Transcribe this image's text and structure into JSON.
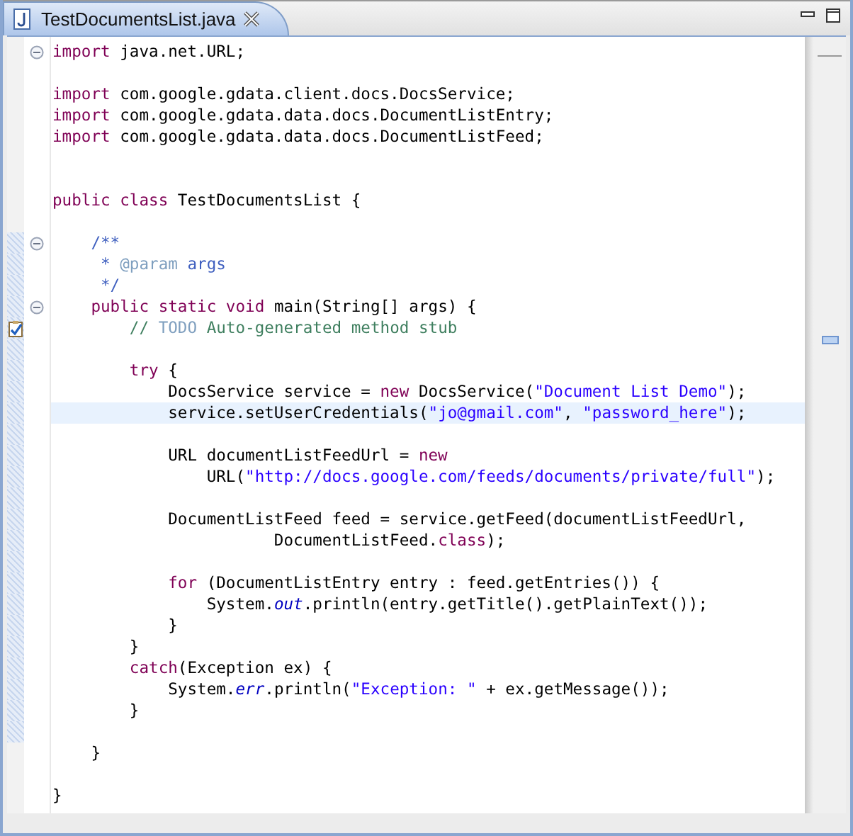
{
  "tab": {
    "label": "TestDocumentsList.java",
    "selected": true
  },
  "lines": [
    {
      "kind": "code",
      "collapsible": true,
      "tokens": [
        {
          "kind": "kw",
          "t": "import"
        },
        {
          "kind": "p",
          "t": " java.net.URL;"
        }
      ]
    },
    {
      "kind": "blank"
    },
    {
      "kind": "code",
      "tokens": [
        {
          "kind": "kw",
          "t": "import"
        },
        {
          "kind": "p",
          "t": " com.google.gdata.client.docs.DocsService;"
        }
      ]
    },
    {
      "kind": "code",
      "tokens": [
        {
          "kind": "kw",
          "t": "import"
        },
        {
          "kind": "p",
          "t": " com.google.gdata.data.docs.DocumentListEntry;"
        }
      ]
    },
    {
      "kind": "code",
      "tokens": [
        {
          "kind": "kw",
          "t": "import"
        },
        {
          "kind": "p",
          "t": " com.google.gdata.data.docs.DocumentListFeed;"
        }
      ]
    },
    {
      "kind": "blank"
    },
    {
      "kind": "blank"
    },
    {
      "kind": "code",
      "tokens": [
        {
          "kind": "kw",
          "t": "public class"
        },
        {
          "kind": "p",
          "t": " TestDocumentsList {"
        }
      ]
    },
    {
      "kind": "blank"
    },
    {
      "kind": "code",
      "collapsible": true,
      "in_range": true,
      "tokens": [
        {
          "kind": "doc",
          "t": "    /**"
        }
      ]
    },
    {
      "kind": "code",
      "in_range": true,
      "tokens": [
        {
          "kind": "doc",
          "t": "     * "
        },
        {
          "kind": "tag",
          "t": "@param"
        },
        {
          "kind": "doc",
          "t": " args"
        }
      ]
    },
    {
      "kind": "code",
      "in_range": true,
      "tokens": [
        {
          "kind": "doc",
          "t": "     */"
        }
      ]
    },
    {
      "kind": "code",
      "collapsible": true,
      "in_range": true,
      "tokens": [
        {
          "kind": "kw",
          "t": "    public static void"
        },
        {
          "kind": "p",
          "t": " main(String[] args) {"
        }
      ]
    },
    {
      "kind": "code",
      "task": true,
      "in_range": true,
      "tokens": [
        {
          "kind": "comment",
          "t": "        // "
        },
        {
          "kind": "todo",
          "t": "TODO"
        },
        {
          "kind": "comment",
          "t": " Auto-generated method stub"
        }
      ]
    },
    {
      "kind": "blank",
      "in_range": true
    },
    {
      "kind": "code",
      "in_range": true,
      "tokens": [
        {
          "kind": "kw",
          "t": "        try"
        },
        {
          "kind": "p",
          "t": " {"
        }
      ]
    },
    {
      "kind": "code",
      "in_range": true,
      "tokens": [
        {
          "kind": "p",
          "t": "            DocsService service = "
        },
        {
          "kind": "kw",
          "t": "new"
        },
        {
          "kind": "p",
          "t": " DocsService("
        },
        {
          "kind": "str",
          "t": "\"Document List Demo\""
        },
        {
          "kind": "p",
          "t": ");"
        }
      ]
    },
    {
      "kind": "code",
      "current": true,
      "in_range": true,
      "tokens": [
        {
          "kind": "p",
          "t": "            service.setUserCredentials("
        },
        {
          "kind": "str",
          "t": "\"jo@gmail.com\""
        },
        {
          "kind": "p",
          "t": ", "
        },
        {
          "kind": "str",
          "t": "\"password_here\""
        },
        {
          "kind": "p",
          "t": ");"
        }
      ]
    },
    {
      "kind": "blank",
      "in_range": true
    },
    {
      "kind": "code",
      "in_range": true,
      "tokens": [
        {
          "kind": "p",
          "t": "            URL documentListFeedUrl = "
        },
        {
          "kind": "kw",
          "t": "new"
        }
      ]
    },
    {
      "kind": "code",
      "in_range": true,
      "tokens": [
        {
          "kind": "p",
          "t": "                URL("
        },
        {
          "kind": "str",
          "t": "\"http://docs.google.com/feeds/documents/private/full\""
        },
        {
          "kind": "p",
          "t": ");"
        }
      ]
    },
    {
      "kind": "blank",
      "in_range": true
    },
    {
      "kind": "code",
      "in_range": true,
      "tokens": [
        {
          "kind": "p",
          "t": "            DocumentListFeed feed = service.getFeed(documentListFeedUrl,"
        }
      ]
    },
    {
      "kind": "code",
      "in_range": true,
      "tokens": [
        {
          "kind": "p",
          "t": "                       DocumentListFeed."
        },
        {
          "kind": "kw",
          "t": "class"
        },
        {
          "kind": "p",
          "t": ");"
        }
      ]
    },
    {
      "kind": "blank",
      "in_range": true
    },
    {
      "kind": "code",
      "in_range": true,
      "tokens": [
        {
          "kind": "kw",
          "t": "            for"
        },
        {
          "kind": "p",
          "t": " (DocumentListEntry entry : feed.getEntries()) {"
        }
      ]
    },
    {
      "kind": "code",
      "in_range": true,
      "tokens": [
        {
          "kind": "p",
          "t": "                System."
        },
        {
          "kind": "field",
          "t": "out"
        },
        {
          "kind": "p",
          "t": ".println(entry.getTitle().getPlainText());"
        }
      ]
    },
    {
      "kind": "code",
      "in_range": true,
      "tokens": [
        {
          "kind": "p",
          "t": "            }"
        }
      ]
    },
    {
      "kind": "code",
      "in_range": true,
      "tokens": [
        {
          "kind": "p",
          "t": "        }"
        }
      ]
    },
    {
      "kind": "code",
      "in_range": true,
      "tokens": [
        {
          "kind": "kw",
          "t": "        catch"
        },
        {
          "kind": "p",
          "t": "(Exception ex) {"
        }
      ]
    },
    {
      "kind": "code",
      "in_range": true,
      "tokens": [
        {
          "kind": "p",
          "t": "            System."
        },
        {
          "kind": "field",
          "t": "err"
        },
        {
          "kind": "p",
          "t": ".println("
        },
        {
          "kind": "str",
          "t": "\"Exception: \""
        },
        {
          "kind": "p",
          "t": " + ex.getMessage());"
        }
      ]
    },
    {
      "kind": "code",
      "in_range": true,
      "tokens": [
        {
          "kind": "p",
          "t": "        }"
        }
      ]
    },
    {
      "kind": "blank",
      "in_range": true
    },
    {
      "kind": "code",
      "tokens": [
        {
          "kind": "p",
          "t": "    }"
        }
      ]
    },
    {
      "kind": "blank"
    },
    {
      "kind": "code",
      "tokens": [
        {
          "kind": "p",
          "t": "}"
        }
      ]
    }
  ]
}
